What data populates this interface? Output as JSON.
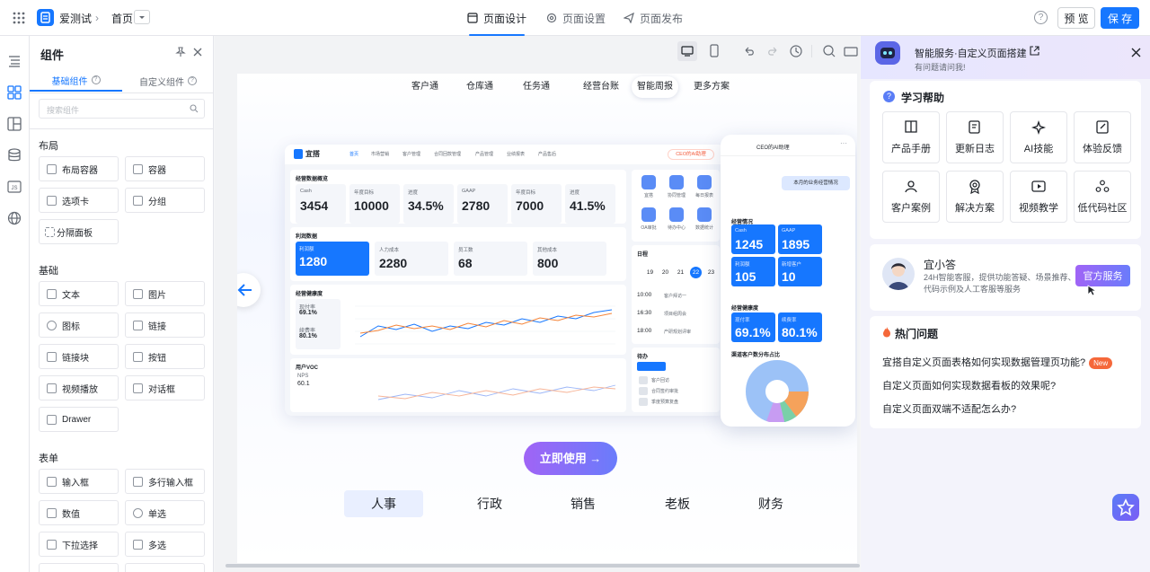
{
  "app": {
    "name": "爱测试",
    "breadcrumb": "首页"
  },
  "top_tabs": [
    {
      "label": "页面设计",
      "icon": "layout-icon"
    },
    {
      "label": "页面设置",
      "icon": "gear-icon"
    },
    {
      "label": "页面发布",
      "icon": "send-icon"
    }
  ],
  "top_actions": {
    "preview": "预 览",
    "save": "保 存"
  },
  "panel": {
    "title": "组件",
    "tabs": [
      "基础组件",
      "自定义组件"
    ],
    "search_placeholder": "搜索组件",
    "sections": [
      {
        "title": "布局",
        "items": [
          "布局容器",
          "容器",
          "选项卡",
          "分组",
          "分隔面板"
        ]
      },
      {
        "title": "基础",
        "items": [
          "文本",
          "图片",
          "图标",
          "链接",
          "链接块",
          "按钮",
          "视频播放",
          "对话框",
          "Drawer"
        ]
      },
      {
        "title": "表单",
        "items": [
          "输入框",
          "多行输入框",
          "数值",
          "单选",
          "下拉选择",
          "多选"
        ]
      }
    ]
  },
  "canvas": {
    "product_tabs": [
      "客户通",
      "仓库通",
      "任务通",
      "经营台账",
      "智能周报",
      "更多方案"
    ],
    "active_product_tab": 4,
    "cta": "立即使用 →",
    "roles": [
      "人事",
      "行政",
      "销售",
      "老板",
      "财务"
    ],
    "active_role": 0,
    "dashboard": {
      "brand": "宜搭",
      "nav": [
        "首页",
        "市场营销",
        "客户管理",
        "合同回款管理",
        "产品管理",
        "业绩报表",
        "产品售后"
      ],
      "ceo_label": "CEO的AI助理",
      "overview_title": "经营数据概览",
      "kpis1": [
        {
          "label": "Cash",
          "value": "3454"
        },
        {
          "label": "年度目标",
          "value": "10000"
        },
        {
          "label": "进度",
          "value": "34.5%"
        },
        {
          "label": "GAAP",
          "value": "2780"
        },
        {
          "label": "年度目标",
          "value": "7000"
        },
        {
          "label": "进度",
          "value": "41.5%"
        }
      ],
      "profit_title": "利润数据",
      "kpis2": [
        {
          "label": "利润额",
          "value": "1280"
        },
        {
          "label": "人力成本",
          "value": "2280"
        },
        {
          "label": "员工数",
          "value": "68"
        },
        {
          "label": "其他成本",
          "value": "800"
        }
      ],
      "health_title": "经营健康度",
      "health_stats": [
        {
          "label": "现付率",
          "value": "69.1%"
        },
        {
          "label": "续费率",
          "value": "80.1%"
        }
      ],
      "voc_title": "用户VOC",
      "nps_label": "NPS",
      "nps_value": "60.1",
      "calendar_title": "日程",
      "calendar_days": [
        "19",
        "20",
        "21",
        "22",
        "23"
      ],
      "schedule": [
        {
          "time": "10:00",
          "text": "客户拜访一"
        },
        {
          "time": "16:30",
          "text": "项目组周会"
        },
        {
          "time": "18:00",
          "text": "产研规划评审"
        }
      ],
      "todo_title": "待办",
      "todos": [
        "客户回访",
        "合同签约审批",
        "季度预算复盘"
      ],
      "apps": [
        "宜搭",
        "协同管理",
        "每日报表",
        "OA审批",
        "待办中心",
        "数据统计"
      ]
    },
    "phone": {
      "title": "CEO的AI助理",
      "bubble": "本月的业务经营情况",
      "section1": "经营情况",
      "stats": [
        {
          "label": "Cash",
          "value": "1245"
        },
        {
          "label": "GAAP",
          "value": "1895"
        },
        {
          "label": "利润额",
          "value": "105"
        },
        {
          "label": "新增客户",
          "value": "10"
        }
      ],
      "section2": "经营健康度",
      "health": [
        {
          "label": "现付率",
          "value": "69.1%"
        },
        {
          "label": "续费率",
          "value": "80.1%"
        }
      ],
      "section3": "渠道客户数分布占比"
    }
  },
  "assistant": {
    "title": "智能服务·自定义页面搭建",
    "subtitle": "有问题请问我!",
    "help_title": "学习帮助",
    "help_items": [
      {
        "label": "产品手册",
        "icon": "book-icon"
      },
      {
        "label": "更新日志",
        "icon": "log-icon"
      },
      {
        "label": "AI技能",
        "icon": "sparkle-icon"
      },
      {
        "label": "体验反馈",
        "icon": "feedback-icon"
      },
      {
        "label": "客户案例",
        "icon": "user-icon"
      },
      {
        "label": "解决方案",
        "icon": "badge-icon"
      },
      {
        "label": "视频教学",
        "icon": "video-icon"
      },
      {
        "label": "低代码社区",
        "icon": "community-icon"
      }
    ],
    "agent": {
      "name": "宜小答",
      "desc": "24H智能客服，提供功能答疑、场景推荐、代码示例及人工客服等服务",
      "button": "官方服务"
    },
    "hot_title": "热门问题",
    "questions": [
      "宜搭自定义页面表格如何实现数据管理页功能?",
      "自定义页面如何实现数据看板的效果呢?",
      "自定义页面双端不适配怎么办?"
    ],
    "new_badge": "New"
  },
  "colors": {
    "primary": "#1677ff",
    "accent_purple": "#7b5cf5"
  }
}
